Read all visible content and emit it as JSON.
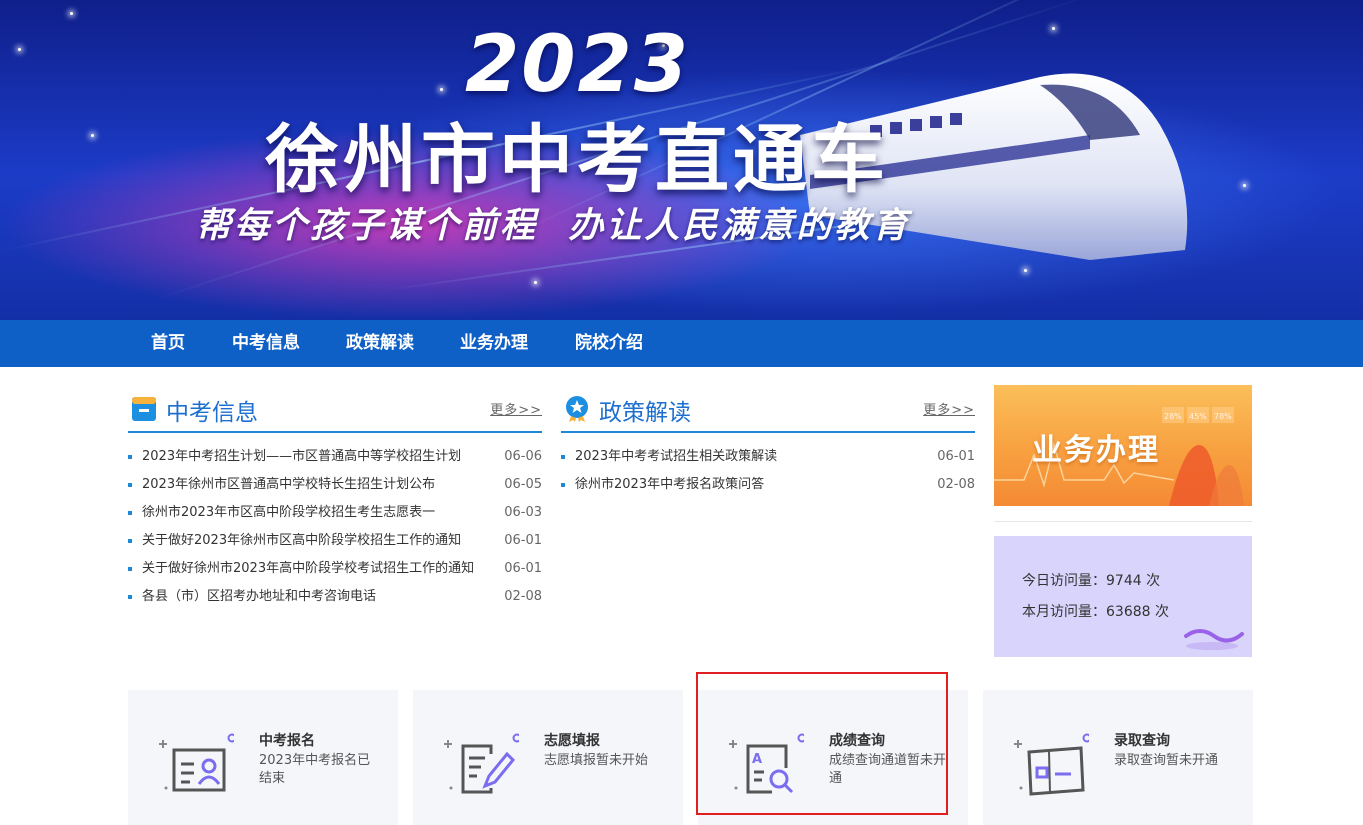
{
  "banner": {
    "year": "2023",
    "title": "徐州市中考直通车",
    "slogan": "帮每个孩子谋个前程  办让人民满意的教育"
  },
  "nav": {
    "items": [
      {
        "label": "首页"
      },
      {
        "label": "中考信息"
      },
      {
        "label": "政策解读"
      },
      {
        "label": "业务办理"
      },
      {
        "label": "院校介绍"
      }
    ]
  },
  "info": {
    "title": "中考信息",
    "more": "更多>>",
    "items": [
      {
        "text": "2023年中考招生计划——市区普通高中等学校招生计划",
        "date": "06-06"
      },
      {
        "text": "2023年徐州市区普通高中学校特长生招生计划公布",
        "date": "06-05"
      },
      {
        "text": "徐州市2023年市区高中阶段学校招生考生志愿表一",
        "date": "06-03"
      },
      {
        "text": "关于做好2023年徐州市区高中阶段学校招生工作的通知",
        "date": "06-01"
      },
      {
        "text": "关于做好徐州市2023年高中阶段学校考试招生工作的通知",
        "date": "06-01"
      },
      {
        "text": "各县（市）区招考办地址和中考咨询电话",
        "date": "02-08"
      }
    ]
  },
  "policy": {
    "title": "政策解读",
    "more": "更多>>",
    "items": [
      {
        "text": "2023年中考考试招生相关政策解读",
        "date": "06-01"
      },
      {
        "text": "徐州市2023年中考报名政策问答",
        "date": "02-08"
      }
    ]
  },
  "business": {
    "label": "业务办理",
    "deco": [
      "28%",
      "45%",
      "78%"
    ]
  },
  "stats": {
    "today_label": "今日访问量：",
    "today_value": "9744",
    "month_label": "本月访问量：",
    "month_value": "63688",
    "unit": "次"
  },
  "services": [
    {
      "title": "中考报名",
      "desc": "2023年中考报名已结束"
    },
    {
      "title": "志愿填报",
      "desc": "志愿填报暂未开始"
    },
    {
      "title": "成绩查询",
      "desc": "成绩查询通道暂未开通"
    },
    {
      "title": "录取查询",
      "desc": "录取查询暂未开通"
    }
  ],
  "colors": {
    "nav_bg": "#0e5fc6",
    "accent": "#1d87d8",
    "icon_accent": "#7b6df0",
    "highlight": "#e02020"
  }
}
